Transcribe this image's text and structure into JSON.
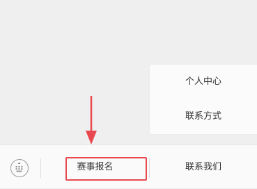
{
  "submenu": {
    "items": [
      {
        "label": "个人中心"
      },
      {
        "label": "联系方式"
      }
    ]
  },
  "menu_bar": {
    "keyboard_icon": "keyboard-icon",
    "tabs": [
      {
        "label": "赛事报名"
      },
      {
        "label": "联系我们"
      }
    ]
  },
  "annotation": {
    "color": "#e8494f",
    "target": "赛事报名"
  },
  "colors": {
    "background": "#efefef",
    "menu_bar": "#fafafa",
    "text": "#333333",
    "annotation": "#e8494f"
  }
}
